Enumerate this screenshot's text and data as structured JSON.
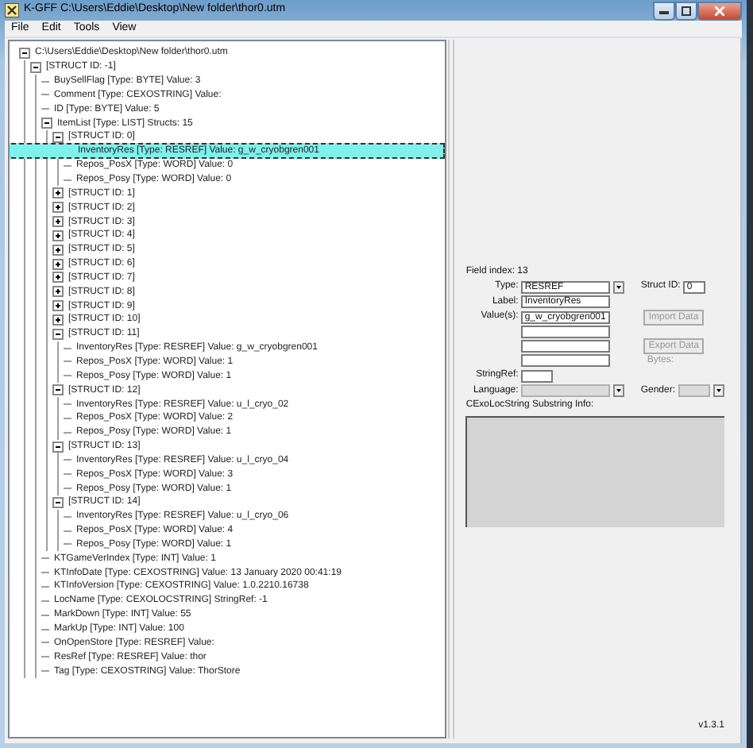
{
  "window": {
    "title": "K-GFF C:\\Users\\Eddie\\Desktop\\New folder\\thor0.utm"
  },
  "menu": [
    {
      "label": "File"
    },
    {
      "label": "Edit"
    },
    {
      "label": "Tools"
    },
    {
      "label": "View"
    }
  ],
  "tree": {
    "label": "C:\\Users\\Eddie\\Desktop\\New folder\\thor0.utm",
    "expanded": true,
    "selected": false,
    "children": [
      {
        "label": "[STRUCT ID: -1]",
        "expanded": true,
        "selected": false,
        "children": [
          {
            "label": "BuySellFlag [Type: BYTE] Value: 3",
            "selected": false
          },
          {
            "label": "Comment [Type: CEXOSTRING] Value:",
            "selected": false
          },
          {
            "label": "ID [Type: BYTE] Value: 5",
            "selected": false
          },
          {
            "label": "ItemList [Type: LIST]  Structs: 15",
            "expanded": true,
            "selected": false,
            "children": [
              {
                "label": "[STRUCT ID: 0]",
                "expanded": true,
                "selected": false,
                "children": [
                  {
                    "label": "InventoryRes [Type: RESREF] Value: g_w_cryobgren001",
                    "selected": true
                  },
                  {
                    "label": "Repos_PosX [Type: WORD] Value: 0",
                    "selected": false
                  },
                  {
                    "label": "Repos_Posy [Type: WORD] Value: 0",
                    "selected": false
                  }
                ]
              },
              {
                "label": "[STRUCT ID: 1]",
                "expanded": false,
                "selected": false
              },
              {
                "label": "[STRUCT ID: 2]",
                "expanded": false,
                "selected": false
              },
              {
                "label": "[STRUCT ID: 3]",
                "expanded": false,
                "selected": false
              },
              {
                "label": "[STRUCT ID: 4]",
                "expanded": false,
                "selected": false
              },
              {
                "label": "[STRUCT ID: 5]",
                "expanded": false,
                "selected": false
              },
              {
                "label": "[STRUCT ID: 6]",
                "expanded": false,
                "selected": false
              },
              {
                "label": "[STRUCT ID: 7]",
                "expanded": false,
                "selected": false
              },
              {
                "label": "[STRUCT ID: 8]",
                "expanded": false,
                "selected": false
              },
              {
                "label": "[STRUCT ID: 9]",
                "expanded": false,
                "selected": false
              },
              {
                "label": "[STRUCT ID: 10]",
                "expanded": false,
                "selected": false
              },
              {
                "label": "[STRUCT ID: 11]",
                "expanded": true,
                "selected": false,
                "children": [
                  {
                    "label": "InventoryRes [Type: RESREF] Value: g_w_cryobgren001",
                    "selected": false
                  },
                  {
                    "label": "Repos_PosX [Type: WORD] Value: 1",
                    "selected": false
                  },
                  {
                    "label": "Repos_Posy [Type: WORD] Value: 1",
                    "selected": false
                  }
                ]
              },
              {
                "label": "[STRUCT ID: 12]",
                "expanded": true,
                "selected": false,
                "children": [
                  {
                    "label": "InventoryRes [Type: RESREF] Value: u_l_cryo_02",
                    "selected": false
                  },
                  {
                    "label": "Repos_PosX [Type: WORD] Value: 2",
                    "selected": false
                  },
                  {
                    "label": "Repos_Posy [Type: WORD] Value: 1",
                    "selected": false
                  }
                ]
              },
              {
                "label": "[STRUCT ID: 13]",
                "expanded": true,
                "selected": false,
                "children": [
                  {
                    "label": "InventoryRes [Type: RESREF] Value: u_l_cryo_04",
                    "selected": false
                  },
                  {
                    "label": "Repos_PosX [Type: WORD] Value: 3",
                    "selected": false
                  },
                  {
                    "label": "Repos_Posy [Type: WORD] Value: 1",
                    "selected": false
                  }
                ]
              },
              {
                "label": "[STRUCT ID: 14]",
                "expanded": true,
                "selected": false,
                "children": [
                  {
                    "label": "InventoryRes [Type: RESREF] Value: u_l_cryo_06",
                    "selected": false
                  },
                  {
                    "label": "Repos_PosX [Type: WORD] Value: 4",
                    "selected": false
                  },
                  {
                    "label": "Repos_Posy [Type: WORD] Value: 1",
                    "selected": false
                  }
                ]
              }
            ]
          },
          {
            "label": "KTGameVerIndex [Type: INT] Value: 1",
            "selected": false
          },
          {
            "label": "KTInfoDate [Type: CEXOSTRING] Value: 13 January 2020 00:41:19",
            "selected": false
          },
          {
            "label": "KTInfoVersion [Type: CEXOSTRING] Value: 1.0.2210.16738",
            "selected": false
          },
          {
            "label": "LocName [Type: CEXOLOCSTRING] StringRef: -1",
            "selected": false
          },
          {
            "label": "MarkDown [Type: INT] Value: 55",
            "selected": false
          },
          {
            "label": "MarkUp [Type: INT] Value: 100",
            "selected": false
          },
          {
            "label": "OnOpenStore [Type: RESREF] Value:",
            "selected": false
          },
          {
            "label": "ResRef [Type: RESREF] Value: thor",
            "selected": false
          },
          {
            "label": "Tag [Type: CEXOSTRING] Value: ThorStore",
            "selected": false
          }
        ]
      }
    ]
  },
  "details": {
    "field_index": "Field index: 13",
    "type": {
      "label": "Type:",
      "value": "RESREF"
    },
    "struct_id": {
      "label": "Struct ID:",
      "value": "0"
    },
    "label_field": {
      "label": "Label:",
      "value": "InventoryRes"
    },
    "values": {
      "label": "Value(s):",
      "value": "g_w_cryobgren001"
    },
    "buttons": [
      {
        "label": "Import Data",
        "disabled": true
      },
      {
        "label": "Export Data",
        "disabled": true
      }
    ],
    "bytes_label": "Bytes:",
    "stringref": {
      "label": "StringRef:"
    },
    "language": {
      "label": "Language:",
      "disabled": true
    },
    "gender": {
      "label": "Gender:",
      "disabled": true
    },
    "substring_label": "CExoLocString Substring Info:"
  },
  "version": "v1.3.1"
}
